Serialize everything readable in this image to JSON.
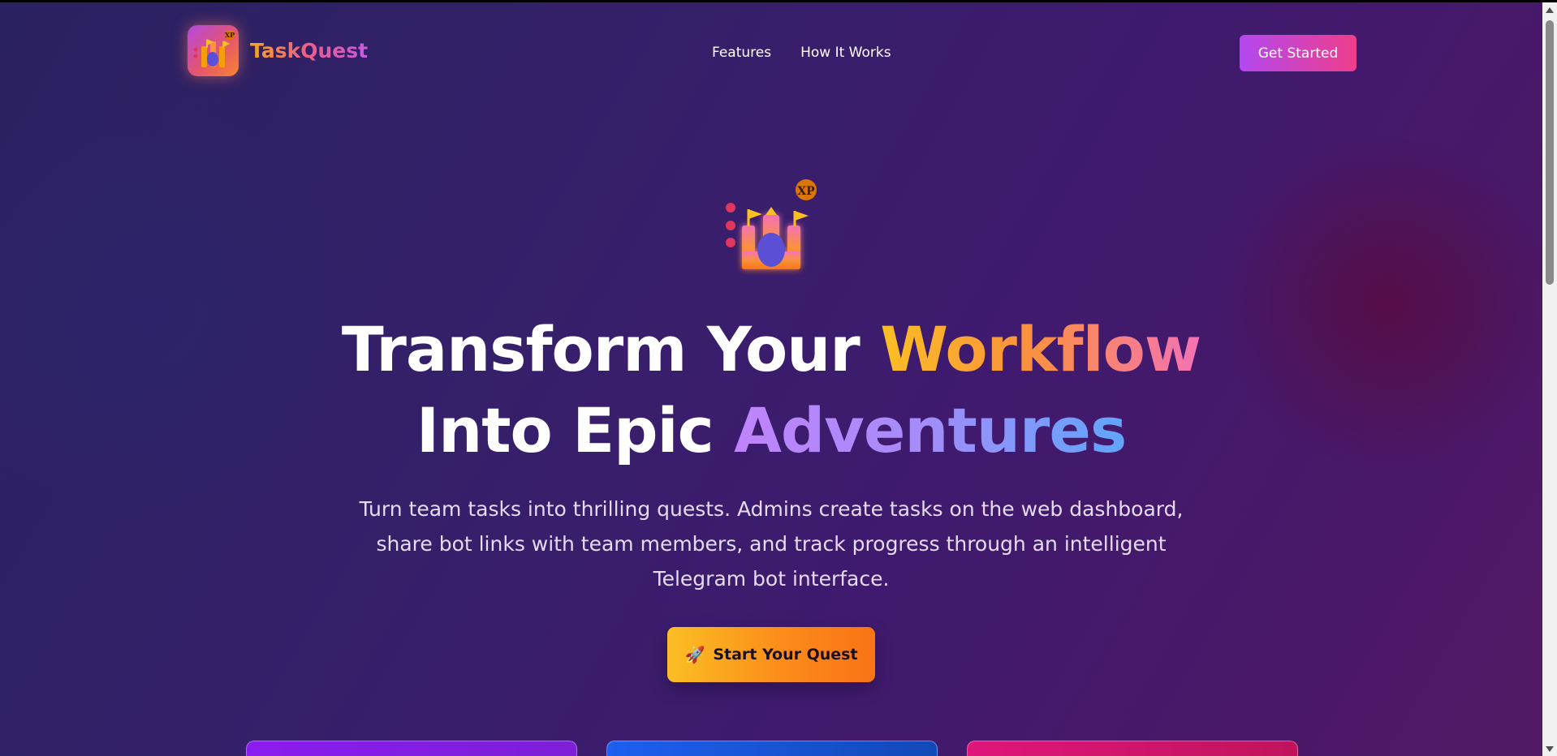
{
  "nav": {
    "brand": {
      "name": "TaskQuest",
      "logo_icon": "castle-logo-icon",
      "logo_badge": "XP"
    },
    "links": [
      {
        "label": "Features"
      },
      {
        "label": "How It Works"
      }
    ],
    "cta_label": "Get Started"
  },
  "hero": {
    "icon": "castle-icon",
    "icon_badge": "XP",
    "headline": {
      "line1_plain": "Transform Your ",
      "line1_accent": "Workflow",
      "line2_plain": "Into Epic ",
      "line2_accent": "Adventures"
    },
    "subtitle_lines": [
      "Turn team tasks into thrilling quests. Admins create tasks on the web dashboard,",
      "share bot links with team members, and track progress through an intelligent",
      "Telegram bot interface."
    ],
    "cta": {
      "icon": "rocket-icon",
      "label": "Start Your Quest"
    }
  },
  "colors": {
    "background_start": "#2a2160",
    "background_end": "#521a64",
    "nav_cta_gradient": [
      "#b348f0",
      "#ef3e8a"
    ],
    "hero_cta_gradient": [
      "#fbbf24",
      "#f97316"
    ],
    "accent_workflow": [
      "#fbbf24",
      "#f472b6"
    ],
    "accent_adventures": [
      "#c084fc",
      "#60a5fa"
    ],
    "card_colors": [
      "#8b1cf0",
      "#1d5ff0",
      "#e0167a"
    ]
  }
}
